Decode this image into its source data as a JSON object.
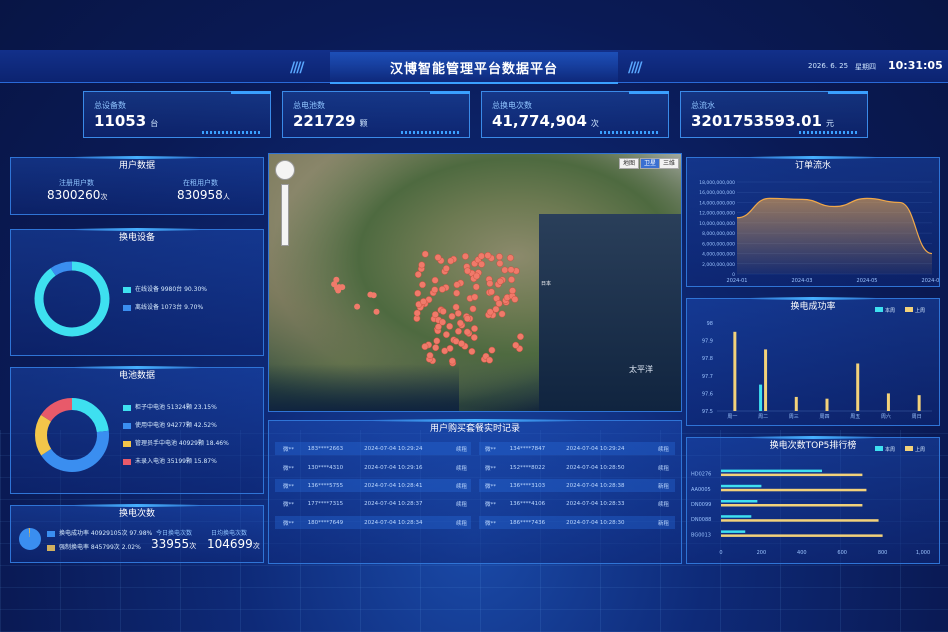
{
  "header": {
    "title": "汉博智能管理平台数据平台",
    "date": "2026. 6. 25",
    "weekday": "星期四",
    "time": "10:31:05"
  },
  "kpis": [
    {
      "label": "总设备数",
      "value": "11053",
      "unit": "台"
    },
    {
      "label": "总电池数",
      "value": "221729",
      "unit": "颗"
    },
    {
      "label": "总换电次数",
      "value": "41,774,904",
      "unit": "次"
    },
    {
      "label": "总流水",
      "value": "3201753593.01",
      "unit": "元"
    }
  ],
  "user_data": {
    "title": "用户数据",
    "registered_label": "注册用户数",
    "registered_value": "8300260",
    "registered_unit": "次",
    "online_label": "在租用户数",
    "online_value": "830958",
    "online_unit": "人"
  },
  "swap_devices": {
    "title": "换电设备",
    "items": [
      {
        "label": "在线设备 9980台 90.30%",
        "color": "#3ee0f0",
        "pct": 90.3
      },
      {
        "label": "离线设备 1073台 9.70%",
        "color": "#3a8ef0",
        "pct": 9.7
      }
    ]
  },
  "battery_data": {
    "title": "电池数据",
    "items": [
      {
        "label": "柜子中电池 51324颗 23.15%",
        "color": "#3ee0f0",
        "pct": 23.15
      },
      {
        "label": "使用中电池 94277颗 42.52%",
        "color": "#3a8ef0",
        "pct": 42.52
      },
      {
        "label": "管理员手中电池 40929颗 18.46%",
        "color": "#f3c64a",
        "pct": 18.46
      },
      {
        "label": "未录入电池 35199颗 15.87%",
        "color": "#e85a6a",
        "pct": 15.87
      }
    ]
  },
  "swap_count": {
    "title": "换电次数",
    "legend": [
      {
        "label": "换电成功率 40929105次 97.98%",
        "color": "#3a8ef0"
      },
      {
        "label": "强制换电率 845799次 2.02%",
        "color": "#d0b060"
      }
    ],
    "today_label": "今日换电次数",
    "today_value": "33955",
    "today_unit": "次",
    "daily_label": "日均换电次数",
    "daily_value": "104699",
    "daily_unit": "次"
  },
  "map": {
    "buttons": [
      "地图",
      "卫星",
      "三维"
    ],
    "labels": [
      "太平洋",
      "日本"
    ]
  },
  "records": {
    "title": "用户购买套餐实时记录",
    "left": [
      [
        "微**",
        "183****2663",
        "2024-07-04 10:29:24",
        "续租"
      ],
      [
        "微**",
        "130****4310",
        "2024-07-04 10:29:16",
        "续租"
      ],
      [
        "微**",
        "136****5755",
        "2024-07-04 10:28:41",
        "续租"
      ],
      [
        "微**",
        "177****7315",
        "2024-07-04 10:28:37",
        "续租"
      ],
      [
        "微**",
        "180****7649",
        "2024-07-04 10:28:34",
        "续租"
      ]
    ],
    "right": [
      [
        "微**",
        "134****7847",
        "2024-07-04 10:29:24",
        "续租"
      ],
      [
        "微**",
        "152****8022",
        "2024-07-04 10:28:50",
        "续租"
      ],
      [
        "微**",
        "136****3103",
        "2024-07-04 10:28:38",
        "新租"
      ],
      [
        "微**",
        "136****4106",
        "2024-07-04 10:28:33",
        "续租"
      ],
      [
        "微**",
        "186****7436",
        "2024-07-04 10:28:30",
        "新租"
      ]
    ]
  },
  "order_flow": {
    "title": "订单流水"
  },
  "success_rate": {
    "title": "换电成功率"
  },
  "top5": {
    "title": "换电次数TOP5排行榜"
  },
  "chart_data": [
    {
      "type": "area",
      "title": "订单流水",
      "x": [
        "2024-01",
        "2024-02",
        "2024-03",
        "2024-04",
        "2024-05",
        "2024-06",
        "2024-07"
      ],
      "values": [
        11000000000,
        14800000000,
        14600000000,
        13200000000,
        14800000000,
        14000000000,
        4000000000
      ],
      "x_ticks": [
        "2024-01",
        "2024-03",
        "2024-05",
        "2024-07"
      ],
      "y_ticks": [
        "0",
        "2,000,000,000",
        "4,000,000,000",
        "6,000,000,000",
        "8,000,000,000",
        "10,000,000,000",
        "12,000,000,000",
        "14,000,000,000",
        "16,000,000,000",
        "18,000,000,000"
      ],
      "ylim": [
        0,
        18000000000
      ],
      "color": "#f0a84a"
    },
    {
      "type": "bar",
      "title": "换电成功率",
      "categories": [
        "周一",
        "周二",
        "周三",
        "周四",
        "周五",
        "周六",
        "周日"
      ],
      "series": [
        {
          "name": "本周",
          "values": [
            97.5,
            97.65,
            97.5,
            97.5,
            97.5,
            97.5,
            97.5
          ],
          "color": "#3ee0f0"
        },
        {
          "name": "上周",
          "values": [
            97.95,
            97.85,
            97.58,
            97.57,
            97.77,
            97.6,
            97.59
          ],
          "color": "#f3d27a"
        }
      ],
      "y_ticks": [
        "97.5",
        "97.6",
        "97.7",
        "97.8",
        "97.9",
        "98"
      ],
      "ylim": [
        97.5,
        98
      ],
      "legend": "top-right"
    },
    {
      "type": "bar",
      "title": "换电次数TOP5排行榜",
      "orientation": "horizontal",
      "categories": [
        "HD0276",
        "AA0005",
        "DN0099",
        "DN0088",
        "BG0013"
      ],
      "series": [
        {
          "name": "本周",
          "values": [
            500,
            200,
            180,
            150,
            120
          ],
          "color": "#3ee0f0"
        },
        {
          "name": "上周",
          "values": [
            700,
            720,
            700,
            780,
            800
          ],
          "color": "#f3d27a"
        }
      ],
      "x_ticks": [
        "0",
        "200",
        "400",
        "600",
        "800",
        "1,000"
      ],
      "xlim": [
        0,
        1000
      ],
      "legend": "top-right"
    }
  ]
}
